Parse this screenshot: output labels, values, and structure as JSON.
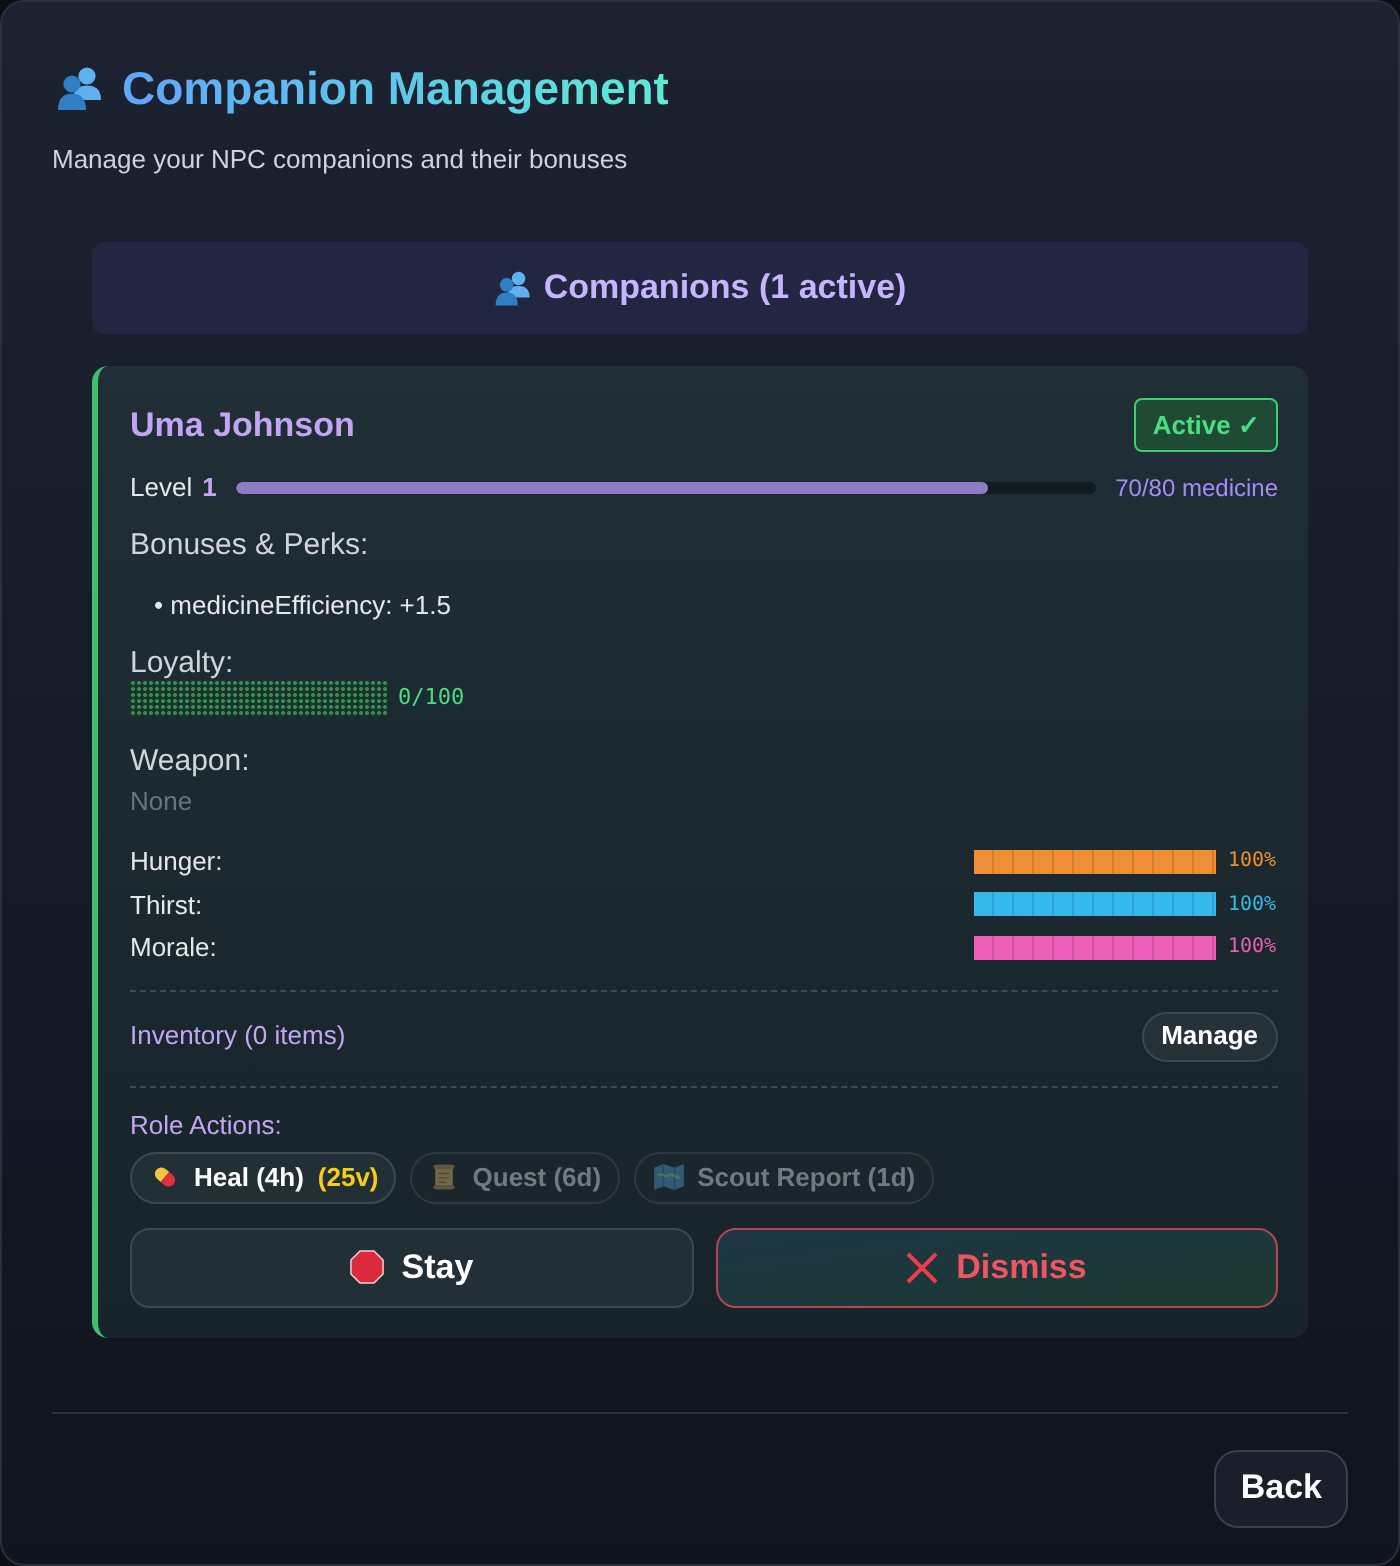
{
  "header": {
    "title": "Companion Management",
    "subtitle": "Manage your NPC companions and their bonuses"
  },
  "section": {
    "title": "Companions (1 active)"
  },
  "companions": [
    {
      "name": "Uma Johnson",
      "active": true,
      "badge": "Active ✓",
      "experience": {
        "label": "Level",
        "value": "1",
        "level": 0.875,
        "reading": "70/80 medicine"
      },
      "bonuses": {
        "title": "Bonuses & Perks:",
        "items": [
          "• medicineEfficiency: +1.5"
        ]
      },
      "loyalty": {
        "title": "Loyalty:",
        "level": 0,
        "reading": "0/100"
      },
      "weapon": {
        "title": "Weapon:",
        "value": "None"
      },
      "stats": [
        {
          "label": "Hunger:",
          "level": 1,
          "reading": "100%",
          "color": "#ee8f35"
        },
        {
          "label": "Thirst:",
          "level": 1,
          "reading": "100%",
          "color": "#35b9ec"
        },
        {
          "label": "Morale:",
          "level": 1,
          "reading": "100%",
          "color": "#ec5fb8"
        }
      ],
      "inventory": {
        "label": "Inventory (0 items)",
        "button": "Manage"
      },
      "role_actions": {
        "title": "Role Actions:",
        "items": [
          {
            "kind": "heal",
            "label": "Heal (4h)",
            "cost": "(25v)",
            "disabled": false
          },
          {
            "kind": "quest",
            "label": "Quest (6d)",
            "disabled": true
          },
          {
            "kind": "scout",
            "label": "Scout Report (1d)",
            "disabled": true
          }
        ]
      },
      "buttons": [
        {
          "kind": "stay",
          "label": "Stay"
        },
        {
          "kind": "dismiss",
          "label": "Dismiss"
        }
      ]
    }
  ],
  "footer": {
    "button": "Back"
  }
}
